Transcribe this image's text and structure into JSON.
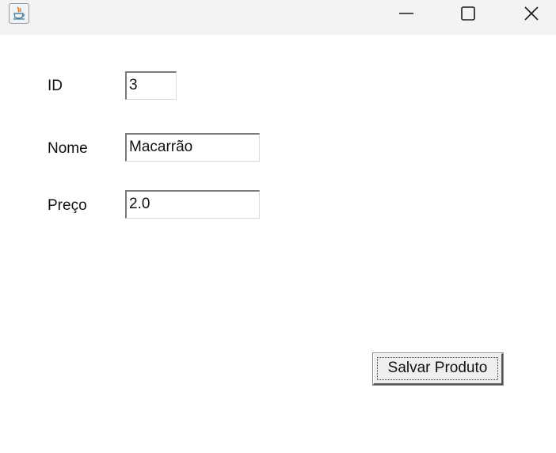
{
  "titlebar": {
    "title": "",
    "icons": {
      "app": "java-cup-icon",
      "minimize": "minimize-icon",
      "maximize": "maximize-icon",
      "close": "close-icon"
    }
  },
  "form": {
    "id": {
      "label": "ID",
      "value": "3"
    },
    "nome": {
      "label": "Nome",
      "value": "Macarrão"
    },
    "preco": {
      "label": "Preço",
      "value": "2.0"
    }
  },
  "actions": {
    "save_label": "Salvar Produto"
  },
  "colors": {
    "titlebar_bg": "#f3f3f3",
    "window_bg": "#ffffff",
    "button_bg": "#efefef"
  }
}
